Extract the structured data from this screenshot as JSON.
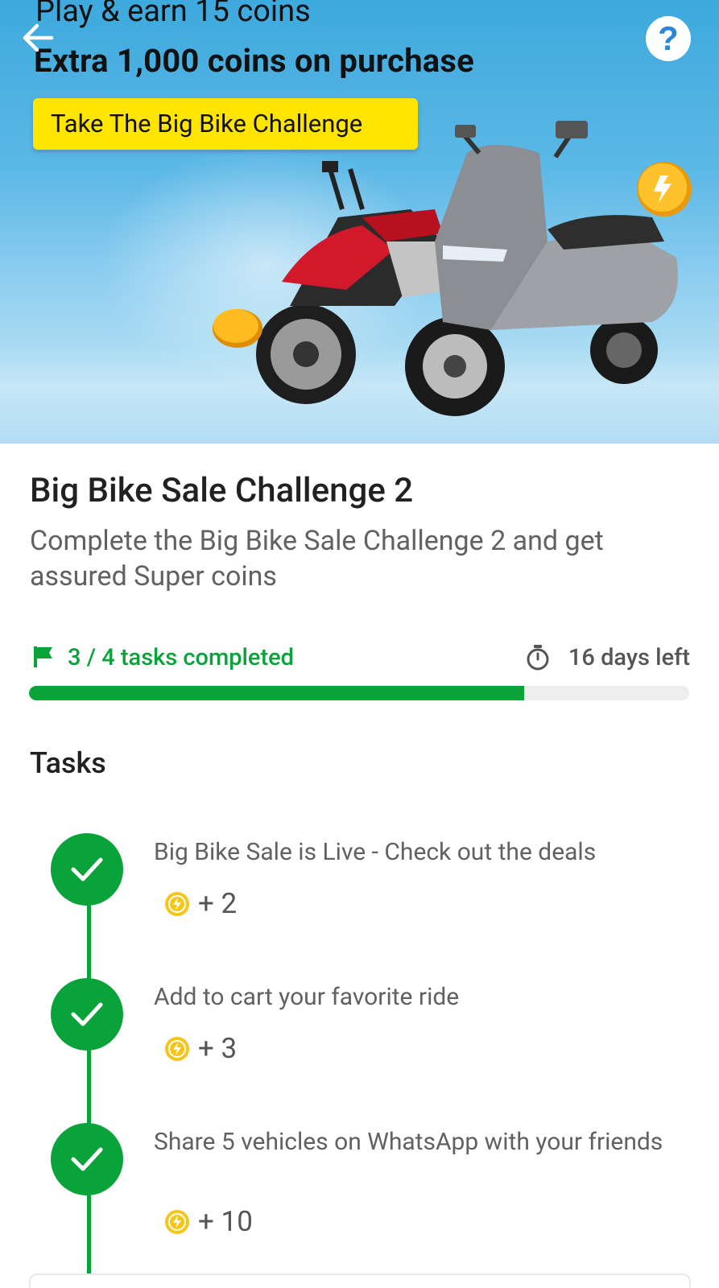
{
  "banner": {
    "line1": "Play & earn 15 coins",
    "line2": "Extra 1,000 coins on purchase",
    "cta_label": "Take The Big Bike Challenge",
    "help_glyph": "?"
  },
  "challenge": {
    "title": "Big Bike Sale Challenge 2",
    "description": "Complete the  Big Bike Sale Challenge 2 and get assured Super coins"
  },
  "progress": {
    "tasks_completed_text": "3 / 4 tasks completed",
    "days_left_text": "16 days left",
    "completed": 3,
    "total": 4,
    "fill_fraction": 0.75
  },
  "tasks_heading": "Tasks",
  "tasks": [
    {
      "label": "Big Bike Sale is Live - Check out the deals",
      "reward": "+ 2",
      "status": "completed"
    },
    {
      "label": "Add to cart your favorite ride",
      "reward": "+ 3",
      "status": "completed"
    },
    {
      "label": "Share 5 vehicles on WhatsApp with your friends",
      "reward": "+ 10",
      "status": "completed"
    }
  ],
  "colors": {
    "accent_green": "#0aa33a",
    "cta_yellow": "#ffe500",
    "coin_yellow": "#f5c518",
    "banner_blue": "#3ea9dd"
  },
  "icons": {
    "back": "arrow-left-icon",
    "help": "question-icon",
    "flag": "flag-icon",
    "timer": "stopwatch-icon",
    "check": "check-icon",
    "coin": "supercoin-icon"
  }
}
